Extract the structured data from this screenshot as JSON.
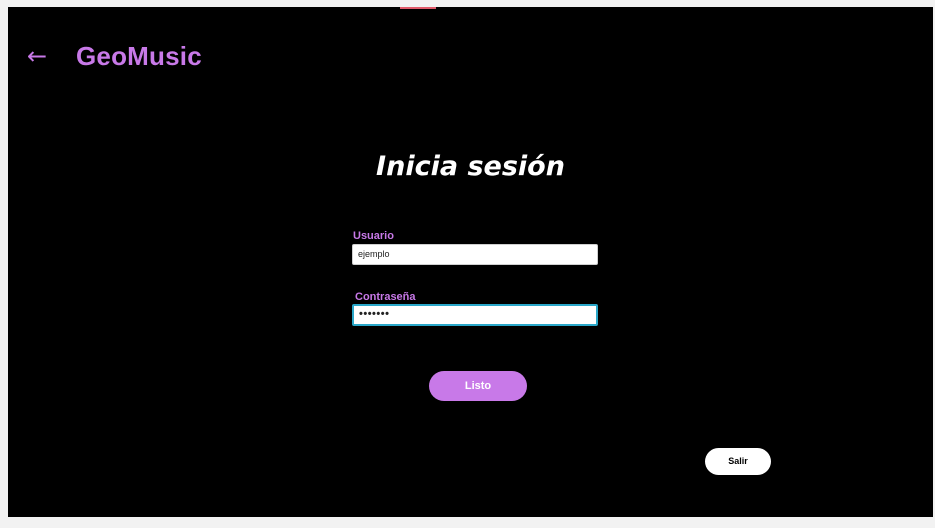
{
  "header": {
    "back_icon": "←",
    "brand": "GeoMusic"
  },
  "login": {
    "title": "Inicia sesión",
    "username_label": "Usuario",
    "username_value": "ejemplo",
    "password_label": "Contraseña",
    "password_value": "•••••••",
    "submit_label": "Listo"
  },
  "footer": {
    "exit_label": "Salir"
  },
  "colors": {
    "background": "#000000",
    "accent": "#c879e8",
    "focus_border": "#2aa7c9"
  },
  "icons": {
    "back": "back-arrow-icon"
  }
}
